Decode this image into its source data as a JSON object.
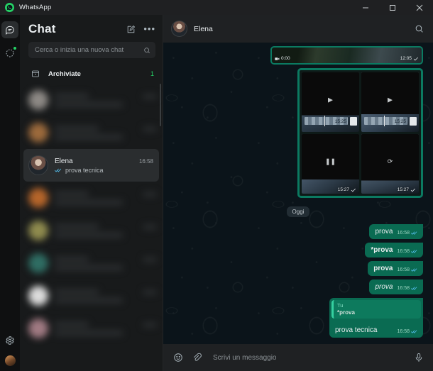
{
  "window": {
    "app_name": "WhatsApp",
    "logo_icon": "whatsapp-logo-icon",
    "minimize_label": "–",
    "maximize_label": "□",
    "close_label": "✕"
  },
  "rail": {
    "items": [
      {
        "name": "chats",
        "icon": "chats-icon",
        "active": true,
        "badge": false
      },
      {
        "name": "status",
        "icon": "status-updates-icon",
        "active": false,
        "badge": true
      }
    ],
    "bottom": [
      {
        "name": "settings",
        "icon": "gear-icon"
      },
      {
        "name": "profile",
        "icon": "avatar-icon"
      }
    ]
  },
  "sidebar": {
    "title": "Chat",
    "new_chat_icon": "new-chat-compose-icon",
    "menu_icon": "overflow-menu-icon",
    "menu_label": "•••",
    "search": {
      "placeholder": "Cerca o inizia una nuova chat",
      "value": "",
      "icon": "search-icon"
    },
    "archived": {
      "icon": "archive-box-icon",
      "label": "Archiviate",
      "count": "1"
    },
    "chats": [
      {
        "name": "",
        "time": "",
        "preview": "",
        "blurred": true,
        "avatar_color": "#8d8985"
      },
      {
        "name": "",
        "time": "",
        "preview": "",
        "blurred": true,
        "avatar_color": "#9c6a3c"
      },
      {
        "name": "Elena",
        "time": "16:58",
        "preview": "prova tecnica",
        "blurred": false,
        "selected": true,
        "status_icon": "double-check-read-icon"
      },
      {
        "name": "",
        "time": "",
        "preview": "",
        "blurred": true,
        "avatar_color": "#b5652a"
      },
      {
        "name": "",
        "time": "",
        "preview": "",
        "blurred": true,
        "avatar_color": "#8f8b4e"
      },
      {
        "name": "",
        "time": "",
        "preview": "",
        "blurred": true,
        "avatar_color": "#2f6d63"
      },
      {
        "name": "",
        "time": "",
        "preview": "",
        "blurred": true,
        "avatar_color": "#dcdcdc"
      },
      {
        "name": "",
        "time": "",
        "preview": "",
        "blurred": true,
        "avatar_color": "#a07a82"
      }
    ]
  },
  "chat": {
    "header": {
      "contact_name": "Elena",
      "search_icon": "search-in-chat-icon"
    },
    "day_divider": "Oggi",
    "video_message": {
      "duration": "0:00",
      "time": "12:05",
      "camera_icon": "video-camera-icon",
      "status_icon": "single-check-sent-icon"
    },
    "media_grid": [
      {
        "time": "15:25",
        "status_icon": "single-check-sent-icon",
        "overlay_icon": "play-icon"
      },
      {
        "time": "15:25",
        "status_icon": "single-check-sent-icon",
        "overlay_icon": "play-icon"
      },
      {
        "time": "15:27",
        "status_icon": "single-check-sent-icon",
        "overlay_icon": "pause-icon"
      },
      {
        "time": "15:27",
        "status_icon": "single-check-sent-icon",
        "overlay_icon": "spinner-icon"
      }
    ],
    "messages": [
      {
        "text": "prova",
        "style": "normal",
        "time": "16:58",
        "status_icon": "double-check-read-icon"
      },
      {
        "text": "*prova",
        "style": "bold",
        "time": "16:58",
        "status_icon": "double-check-read-icon"
      },
      {
        "text": "prova",
        "style": "bold",
        "time": "16:58",
        "status_icon": "double-check-read-icon"
      },
      {
        "text": "prova",
        "style": "italic",
        "time": "16:58",
        "status_icon": "double-check-read-icon"
      }
    ],
    "reply_message": {
      "quote_author": "Tu",
      "quote_text": "*prova",
      "text": "prova tecnica",
      "time": "16:58",
      "status_icon": "double-check-read-icon"
    },
    "composer": {
      "emoji_icon": "emoji-smiley-icon",
      "attach_icon": "paperclip-attach-icon",
      "placeholder": "Scrivi un messaggio",
      "value": "",
      "mic_icon": "microphone-icon"
    }
  },
  "colors": {
    "brand_green": "#25d366",
    "bubble_out": "#0a6b52",
    "read_tick_blue": "#53bdeb",
    "media_border": "#0b7a61"
  }
}
